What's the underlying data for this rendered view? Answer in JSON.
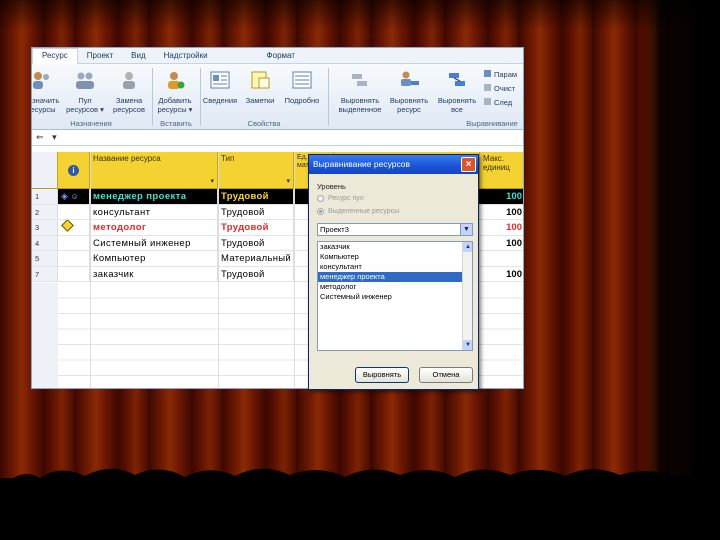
{
  "ribbon": {
    "tabs": [
      "Ресурс",
      "Проект",
      "Вид",
      "Надстройки",
      "Формат"
    ],
    "buttons": [
      {
        "label": "Назначить ресурсы",
        "icon": "assign-resources-icon"
      },
      {
        "label": "Пул ресурсов ▾",
        "icon": "resource-pool-icon"
      },
      {
        "label": "Замена ресурсов",
        "icon": "replace-resources-icon"
      },
      {
        "label": "Добавить ресурсы ▾",
        "icon": "add-resources-icon"
      },
      {
        "label": "Сведения",
        "icon": "info-icon"
      },
      {
        "label": "Заметки",
        "icon": "notes-icon"
      },
      {
        "label": "Подробно",
        "icon": "details-icon"
      },
      {
        "label": "Выровнять выделенное",
        "icon": "level-selection-icon"
      },
      {
        "label": "Выровнять ресурс",
        "icon": "level-resource-icon"
      },
      {
        "label": "Выровнять все",
        "icon": "level-all-icon"
      }
    ],
    "side_items": [
      "Парам",
      "Очист",
      "След"
    ],
    "groups": [
      "Назначения",
      "Вставить",
      "Свойства",
      "Выравнивание"
    ]
  },
  "grid": {
    "headers": {
      "indicator_icon": "info-icon",
      "name": "Название ресурса",
      "type": "Тип",
      "units": "Ед. изм. мат.",
      "max": "Макс. единиц"
    },
    "rows": [
      {
        "num": "1",
        "name": "менеджер проекта",
        "type": "Трудовой",
        "max": "100",
        "state": "selected"
      },
      {
        "num": "2",
        "name": "консультант",
        "type": "Трудовой",
        "max": "100",
        "state": "normal"
      },
      {
        "num": "3",
        "name": "методолог",
        "type": "Трудовой",
        "max": "100",
        "state": "overallocated"
      },
      {
        "num": "4",
        "name": "Системный инженер",
        "type": "Трудовой",
        "max": "100",
        "state": "normal"
      },
      {
        "num": "5",
        "name": "Компьютер",
        "type": "Материальный",
        "max": "",
        "state": "normal"
      },
      {
        "num": "7",
        "name": "заказчик",
        "type": "Трудовой",
        "max": "100",
        "state": "normal"
      }
    ]
  },
  "dialog": {
    "title": "Выравнивание ресурсов",
    "level_label": "Уровень",
    "radio_pool": "Ресурс пул",
    "radio_selected": "Выделенные ресурсы",
    "project_select": "Проект3",
    "resources": [
      "заказчик",
      "Компьютер",
      "консультант",
      "менеджер проекта",
      "методолог",
      "Системный инженер"
    ],
    "selected_resource": "менеджер проекта",
    "ok_label": "Выровнять",
    "cancel_label": "Отмена"
  }
}
